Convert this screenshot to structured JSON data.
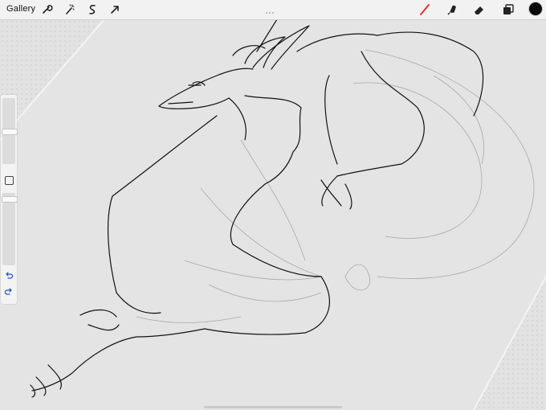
{
  "topbar": {
    "gallery_label": "Gallery",
    "left_tools": [
      "wrench-icon",
      "magic-wand-icon",
      "selection-icon",
      "transform-arrow-icon"
    ],
    "right_tools": [
      "brush-icon",
      "smudge-icon",
      "eraser-icon",
      "layers-icon"
    ],
    "active_tool": "brush-icon",
    "accent_color": "#e0352b",
    "current_color": "#0a0a0a"
  },
  "sidebar": {
    "brush_size": 0.35,
    "opacity": 0.05
  }
}
